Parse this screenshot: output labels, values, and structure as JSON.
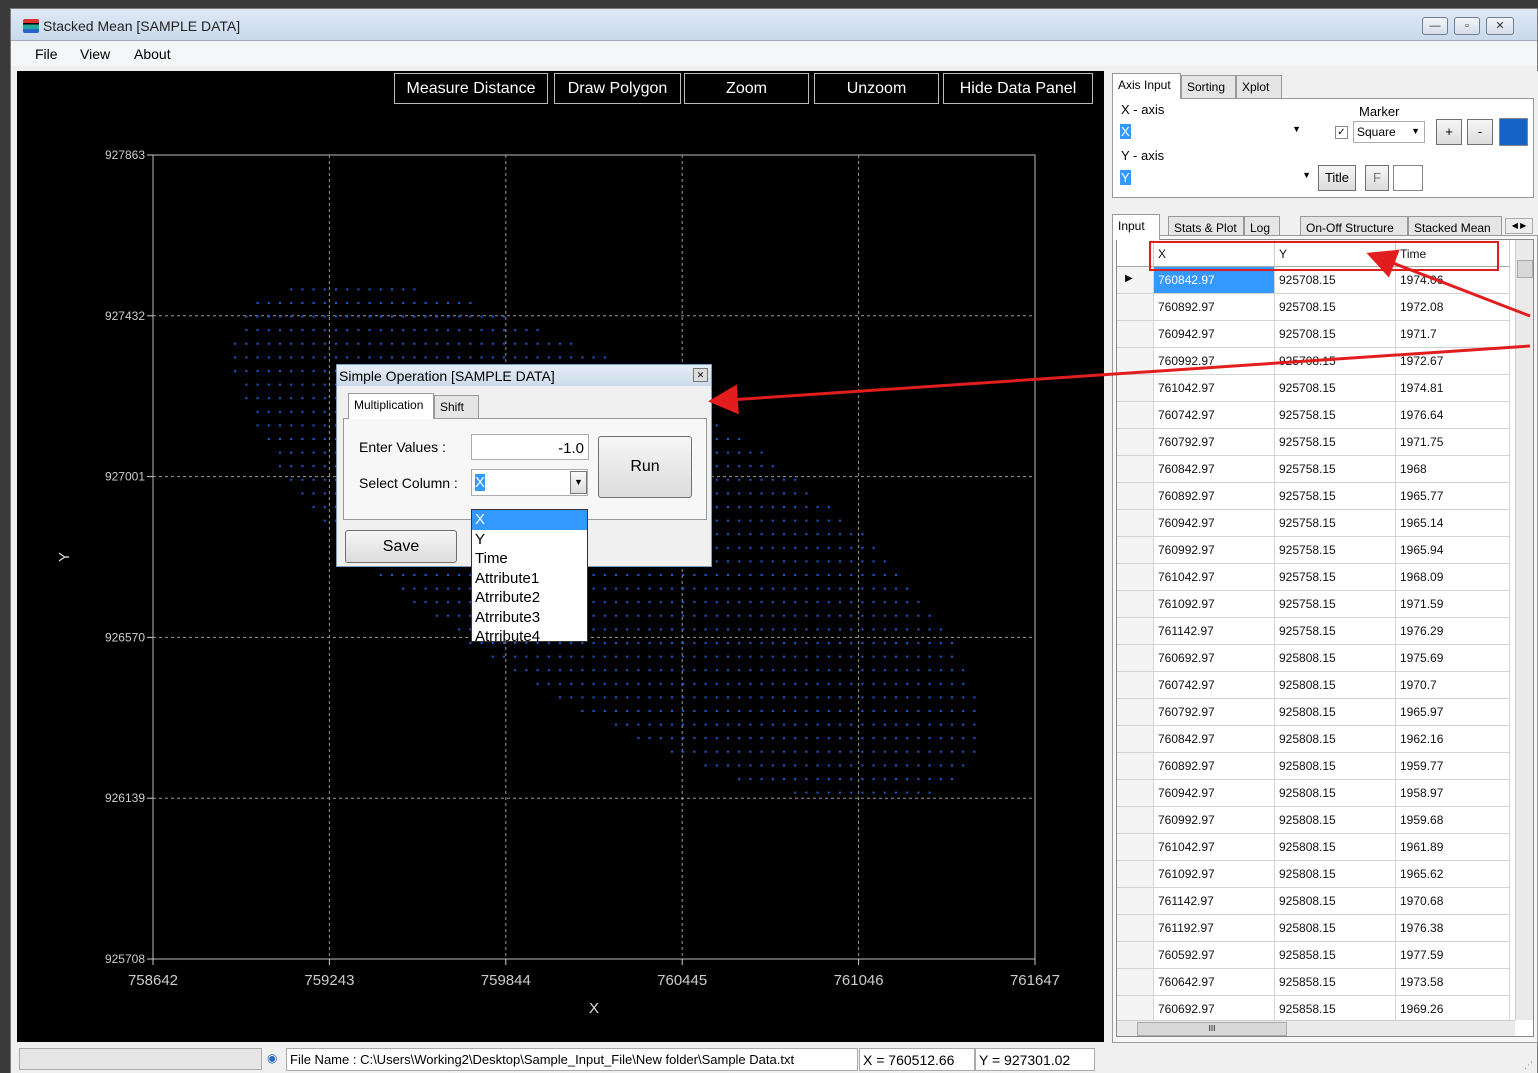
{
  "window": {
    "title": "Stacked Mean [SAMPLE DATA]",
    "controls": [
      "—",
      "▫",
      "✕"
    ]
  },
  "menu": [
    "File",
    "View",
    "About"
  ],
  "toolbar": {
    "measure": "Measure Distance",
    "polygon": "Draw Polygon",
    "zoom": "Zoom",
    "unzoom": "Unzoom",
    "hide": "Hide Data Panel"
  },
  "chart_data": {
    "type": "scatter",
    "xlabel": "X",
    "ylabel": "Y",
    "xlim": [
      758642,
      761647
    ],
    "ylim": [
      925708,
      927863
    ],
    "xticks": [
      "758642",
      "759243",
      "759844",
      "760445",
      "761046",
      "761647"
    ],
    "yticks": [
      "927863",
      "927432",
      "927001",
      "926570",
      "926139",
      "925708"
    ],
    "grid": true,
    "marker": "Square",
    "color": "#1e5ad8"
  },
  "dialog": {
    "title": "Simple Operation [SAMPLE DATA]",
    "tabs": [
      "Multiplication",
      "Shift"
    ],
    "enter_label": "Enter Values :",
    "enter_value": "-1.0",
    "column_label": "Select Column :",
    "column_value": "X",
    "run": "Run",
    "save": "Save",
    "options": [
      "X",
      "Y",
      "Time",
      "Attribute1",
      "Atrribute2",
      "Atrribute3",
      "Atrribute4"
    ]
  },
  "panel": {
    "top_tabs": [
      "Axis Input",
      "Sorting",
      "Xplot"
    ],
    "xaxis_label": "X - axis",
    "xaxis_value": "X",
    "yaxis_label": "Y - axis",
    "yaxis_value": "Y",
    "marker_label": "Marker",
    "marker_value": "Square",
    "plus": "+",
    "minus": "-",
    "title_btn": "Title",
    "f_btn": "F",
    "check": "✓",
    "marker_color": "#1464c8",
    "lower_tabs": [
      "Input",
      "Stats & Plot",
      "Log",
      "On-Off Structure",
      "Stacked Mean"
    ],
    "columns": [
      "X",
      "Y",
      "Time"
    ],
    "rows": [
      [
        "760842.97",
        "925708.15",
        "1974.06"
      ],
      [
        "760892.97",
        "925708.15",
        "1972.08"
      ],
      [
        "760942.97",
        "925708.15",
        "1971.7"
      ],
      [
        "760992.97",
        "925708.15",
        "1972.67"
      ],
      [
        "761042.97",
        "925708.15",
        "1974.81"
      ],
      [
        "760742.97",
        "925758.15",
        "1976.64"
      ],
      [
        "760792.97",
        "925758.15",
        "1971.75"
      ],
      [
        "760842.97",
        "925758.15",
        "1968"
      ],
      [
        "760892.97",
        "925758.15",
        "1965.77"
      ],
      [
        "760942.97",
        "925758.15",
        "1965.14"
      ],
      [
        "760992.97",
        "925758.15",
        "1965.94"
      ],
      [
        "761042.97",
        "925758.15",
        "1968.09"
      ],
      [
        "761092.97",
        "925758.15",
        "1971.59"
      ],
      [
        "761142.97",
        "925758.15",
        "1976.29"
      ],
      [
        "760692.97",
        "925808.15",
        "1975.69"
      ],
      [
        "760742.97",
        "925808.15",
        "1970.7"
      ],
      [
        "760792.97",
        "925808.15",
        "1965.97"
      ],
      [
        "760842.97",
        "925808.15",
        "1962.16"
      ],
      [
        "760892.97",
        "925808.15",
        "1959.77"
      ],
      [
        "760942.97",
        "925808.15",
        "1958.97"
      ],
      [
        "760992.97",
        "925808.15",
        "1959.68"
      ],
      [
        "761042.97",
        "925808.15",
        "1961.89"
      ],
      [
        "761092.97",
        "925808.15",
        "1965.62"
      ],
      [
        "761142.97",
        "925808.15",
        "1970.68"
      ],
      [
        "761192.97",
        "925808.15",
        "1976.38"
      ],
      [
        "760592.97",
        "925858.15",
        "1977.59"
      ],
      [
        "760642.97",
        "925858.15",
        "1973.58"
      ],
      [
        "760692.97",
        "925858.15",
        "1969.26"
      ]
    ],
    "hscroll_mark": "III"
  },
  "status": {
    "file": "File Name : C:\\Users\\Working2\\Desktop\\Sample_Input_File\\New folder\\Sample Data.txt",
    "x": "X = 760512.66",
    "y": "Y = 927301.02"
  }
}
